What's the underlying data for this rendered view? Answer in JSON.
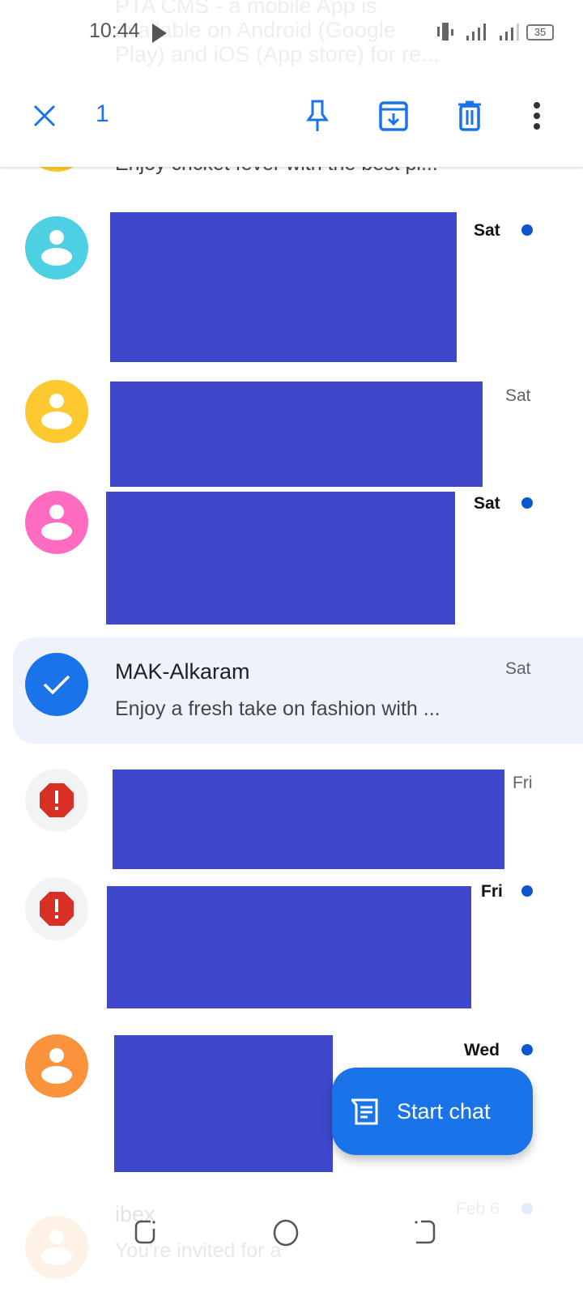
{
  "status_bar": {
    "time": "10:44",
    "battery": "35"
  },
  "background_notification": {
    "line1": "PTA CMS - a mobile App is",
    "line2": "available on Android (Google",
    "line3": "Play) and iOS (App store) for re..."
  },
  "toolbar": {
    "selected_count": "1",
    "icons": [
      "close-icon",
      "pin-icon",
      "archive-icon",
      "delete-icon",
      "more-vert-icon"
    ],
    "accent": "#1a73e8"
  },
  "conversations": [
    {
      "snippet": "Enjoy cricket fever with the best pi...",
      "avatar": "yellow"
    },
    {
      "date": "Sat",
      "unread": true,
      "avatar_color": "#4dd0e1",
      "redacted": true
    },
    {
      "date": "Sat",
      "unread": false,
      "avatar_color": "#fdc830",
      "redacted": true
    },
    {
      "date": "Sat",
      "unread": true,
      "avatar_color": "#ff6bbf",
      "redacted": true
    },
    {
      "title": "MAK-Alkaram",
      "snippet": "Enjoy a fresh take on fashion with ...",
      "date": "Sat",
      "selected": true
    },
    {
      "date": "Fri",
      "unread": false,
      "avatar": "spam-warning",
      "redacted": true
    },
    {
      "date": "Fri",
      "unread": true,
      "avatar": "spam-warning",
      "redacted": true
    },
    {
      "date": "Wed",
      "unread": true,
      "avatar_color": "#fb923c",
      "redacted": true
    },
    {
      "title": "ibex",
      "snippet": "You're invited for a",
      "date": "Feb 6",
      "unread": true,
      "avatar_color": "#fb923c"
    }
  ],
  "fab": {
    "label": "Start chat"
  },
  "redaction_color": "#3f48cc"
}
